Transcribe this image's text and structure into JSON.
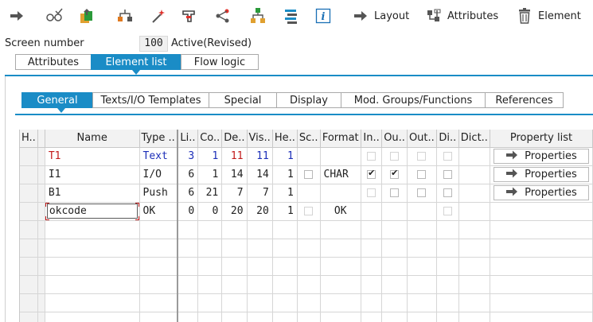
{
  "toolbar": {
    "layout_label": "Layout",
    "attributes_label": "Attributes",
    "element_label": "Element"
  },
  "screen": {
    "number_label": "Screen number",
    "number_value": "100",
    "status": "Active(Revised)"
  },
  "main_tabs": [
    "Attributes",
    "Element list",
    "Flow logic"
  ],
  "main_tab_active": "Element list",
  "sub_tabs": [
    "General",
    "Texts/I/O Templates",
    "Special",
    "Display",
    "Mod. Groups/Functions",
    "References"
  ],
  "sub_tab_active": "General",
  "columns": [
    "H..",
    "",
    "Name",
    "Type ..",
    "Li..",
    "Co..",
    "De..",
    "Vis..",
    "He..",
    "Sc..",
    "Format",
    "In..",
    "Ou..",
    "Out..",
    "Di..",
    "Dict..",
    "Property list"
  ],
  "rows": [
    {
      "name": "T1",
      "type": "Text",
      "line": "3",
      "col": "1",
      "def": "11",
      "vis": "11",
      "height": "1",
      "format": "",
      "property": "Properties"
    },
    {
      "name": "I1",
      "type": "I/O",
      "line": "6",
      "col": "1",
      "def": "14",
      "vis": "14",
      "height": "1",
      "format": "CHAR",
      "property": "Properties"
    },
    {
      "name": "B1",
      "type": "Push",
      "line": "6",
      "col": "21",
      "def": "7",
      "vis": "7",
      "height": "1",
      "format": "",
      "property": "Properties"
    },
    {
      "name": "okcode",
      "type": "OK",
      "line": "0",
      "col": "0",
      "def": "20",
      "vis": "20",
      "height": "1",
      "format": "OK",
      "property": ""
    }
  ],
  "colors": {
    "accent": "#1a8cc6",
    "blue_value": "#1d2fb8",
    "red_value": "#c21b1b"
  }
}
